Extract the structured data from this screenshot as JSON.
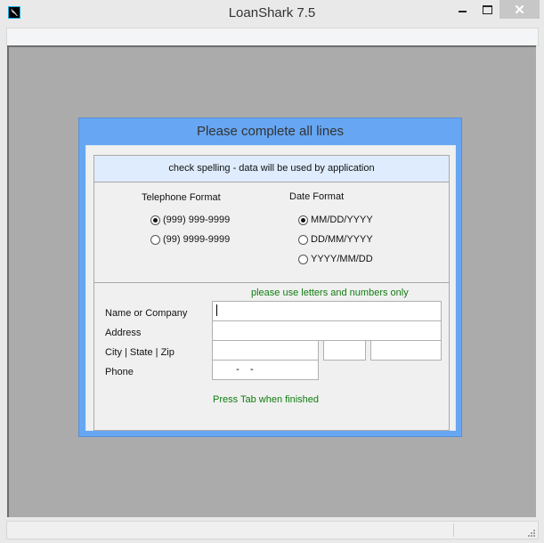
{
  "window": {
    "title": "LoanShark 7.5",
    "app_icon": "shark-app-icon",
    "controls": {
      "minimize": "—",
      "maximize": "☐",
      "close": "✕"
    }
  },
  "dialog": {
    "title": "Please complete all lines",
    "notice": "check spelling - data will be used by application",
    "telephone_format": {
      "label": "Telephone Format",
      "options": [
        {
          "label": "(999) 999-9999",
          "selected": true
        },
        {
          "label": "(99) 9999-9999",
          "selected": false
        }
      ]
    },
    "date_format": {
      "label": "Date Format",
      "options": [
        {
          "label": "MM/DD/YYYY",
          "selected": true
        },
        {
          "label": "DD/MM/YYYY",
          "selected": false
        },
        {
          "label": "YYYY/MM/DD",
          "selected": false
        }
      ]
    },
    "hint_top": "please use letters and numbers only",
    "fields": {
      "name_label": "Name or Company",
      "name_value": "",
      "address_label": "Address",
      "address_value": "",
      "city_state_zip_label": "City | State | Zip",
      "city_value": "",
      "state_value": "",
      "zip_value": "",
      "phone_label": "Phone",
      "phone_value": "   -    -"
    },
    "hint_bottom": "Press Tab when finished"
  },
  "colors": {
    "dialog_frame": "#67a6f2",
    "hint_text": "#107c10",
    "mdi_background": "#ababab",
    "notice_background": "#dfecfd"
  }
}
